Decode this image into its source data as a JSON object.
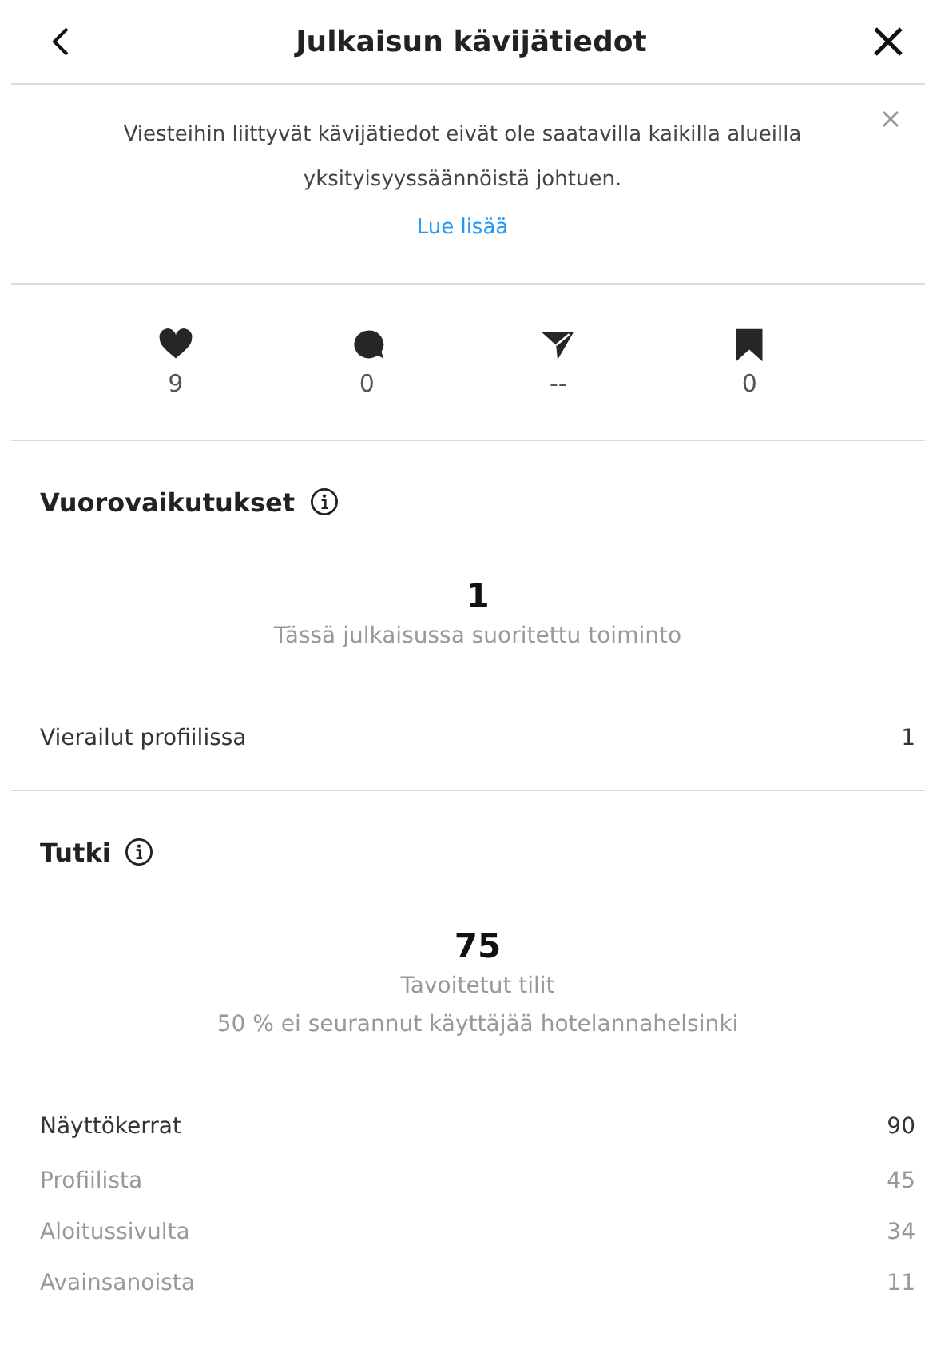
{
  "header": {
    "title": "Julkaisun kävijätiedot"
  },
  "notice": {
    "text": "Viesteihin liittyvät kävijätiedot eivät ole saatavilla kaikilla alueilla yksityisyyssäännöistä johtuen.",
    "link": "Lue lisää"
  },
  "stats": [
    {
      "kind": "likes",
      "value": "9"
    },
    {
      "kind": "comments",
      "value": "0"
    },
    {
      "kind": "shares",
      "value": "--"
    },
    {
      "kind": "saves",
      "value": "0"
    }
  ],
  "sections": [
    {
      "title": "Vuorovaikutukset",
      "big_value": "1",
      "captions": [
        "Tässä julkaisussa suoritettu toiminto"
      ],
      "rows": [
        {
          "kind": "main",
          "label": "Vierailut profiilissa",
          "value": "1"
        }
      ]
    },
    {
      "title": "Tutki",
      "big_value": "75",
      "captions": [
        "Tavoitetut tilit",
        "50 % ei seurannut käyttäjää hotelannahelsinki"
      ],
      "rows": [
        {
          "kind": "main",
          "label": "Näyttökerrat",
          "value": "90"
        },
        {
          "kind": "sub",
          "label": "Profiilista",
          "value": "45"
        },
        {
          "kind": "sub",
          "label": "Aloitussivulta",
          "value": "34"
        },
        {
          "kind": "sub",
          "label": "Avainsanoista",
          "value": "11"
        }
      ]
    }
  ]
}
